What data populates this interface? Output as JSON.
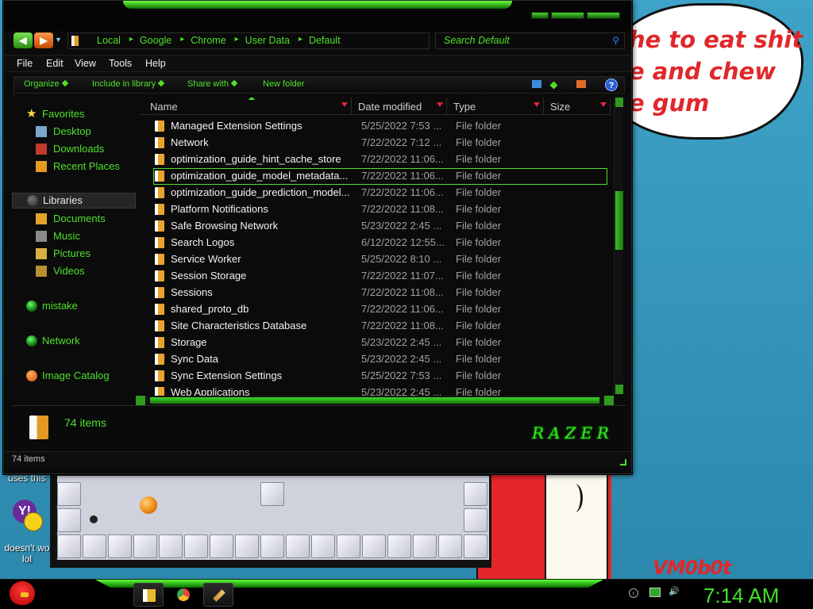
{
  "desktop": {
    "bubble_lines": [
      "he to eat shit",
      "e and chew",
      "e gum"
    ],
    "watermark": "VM0b0t",
    "icon_labels": {
      "top_label": "uses this",
      "yahoo_label_1": "doesn't wo",
      "yahoo_label_2": "lol"
    }
  },
  "explorer": {
    "address": {
      "crumbs": [
        "Local",
        "Google",
        "Chrome",
        "User Data",
        "Default"
      ],
      "search_placeholder": "Search Default"
    },
    "menu": [
      "File",
      "Edit",
      "View",
      "Tools",
      "Help"
    ],
    "commands": [
      "Organize",
      "Include in library",
      "Share with",
      "New folder"
    ],
    "nav": {
      "favorites": {
        "label": "Favorites",
        "items": [
          "Desktop",
          "Downloads",
          "Recent Places"
        ]
      },
      "libraries": {
        "label": "Libraries",
        "items": [
          "Documents",
          "Music",
          "Pictures",
          "Videos"
        ]
      },
      "other": [
        "mistake",
        "Network",
        "Image Catalog"
      ]
    },
    "columns": [
      "Name",
      "Date modified",
      "Type",
      "Size"
    ],
    "files": [
      {
        "name": "Managed Extension Settings",
        "date": "5/25/2022 7:53 ...",
        "type": "File folder"
      },
      {
        "name": "Network",
        "date": "7/22/2022 7:12 ...",
        "type": "File folder"
      },
      {
        "name": "optimization_guide_hint_cache_store",
        "date": "7/22/2022 11:06...",
        "type": "File folder"
      },
      {
        "name": "optimization_guide_model_metadata...",
        "date": "7/22/2022 11:06...",
        "type": "File folder"
      },
      {
        "name": "optimization_guide_prediction_model...",
        "date": "7/22/2022 11:06...",
        "type": "File folder"
      },
      {
        "name": "Platform Notifications",
        "date": "7/22/2022 11:08...",
        "type": "File folder"
      },
      {
        "name": "Safe Browsing Network",
        "date": "5/23/2022 2:45 ...",
        "type": "File folder"
      },
      {
        "name": "Search Logos",
        "date": "6/12/2022 12:55...",
        "type": "File folder"
      },
      {
        "name": "Service Worker",
        "date": "5/25/2022 8:10 ...",
        "type": "File folder"
      },
      {
        "name": "Session Storage",
        "date": "7/22/2022 11:07...",
        "type": "File folder"
      },
      {
        "name": "Sessions",
        "date": "7/22/2022 11:08...",
        "type": "File folder"
      },
      {
        "name": "shared_proto_db",
        "date": "7/22/2022 11:06...",
        "type": "File folder"
      },
      {
        "name": "Site Characteristics Database",
        "date": "7/22/2022 11:08...",
        "type": "File folder"
      },
      {
        "name": "Storage",
        "date": "5/23/2022 2:45 ...",
        "type": "File folder"
      },
      {
        "name": "Sync Data",
        "date": "5/23/2022 2:45 ...",
        "type": "File folder"
      },
      {
        "name": "Sync Extension Settings",
        "date": "5/25/2022 7:53 ...",
        "type": "File folder"
      },
      {
        "name": "Web Applications",
        "date": "5/23/2022 2:45 ...",
        "type": "File folder"
      }
    ],
    "selected_index": 3,
    "details_count": "74 items",
    "brand": "RAZER",
    "status": "74 items"
  },
  "taskbar": {
    "clock": "7:14 AM"
  },
  "colors": {
    "accent": "#4ee12c",
    "window_bg": "#0b0b0b",
    "sort_arrow": "#e0243a"
  }
}
